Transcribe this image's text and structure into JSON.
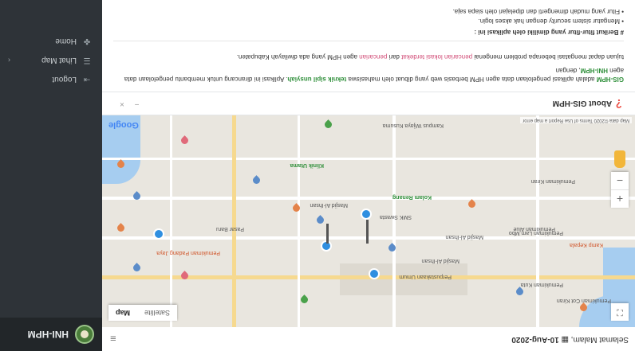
{
  "app": {
    "name": "HNI-HPM"
  },
  "sidebar": {
    "items": [
      {
        "label": "Home",
        "icon": "dashboard-icon"
      },
      {
        "label": "Lihat Map",
        "icon": "list-icon"
      },
      {
        "label": "Logout",
        "icon": "logout-icon"
      }
    ]
  },
  "header": {
    "greeting": "Selamat Malam, ",
    "datetime": "10-Aug-2020"
  },
  "map": {
    "type_map": "Map",
    "type_satellite": "Satellite",
    "zoom_in": "+",
    "zoom_out": "−",
    "fullscreen": "⛶",
    "attribution": "Map data ©2020   Terms of Use   Report a map error",
    "logo": "Google",
    "labels": [
      "Kampus Wijaya Kusuma",
      "Masjid Al-Ihsan",
      "SMK Swasta",
      "Perpustakaan Umum",
      "Pemukiman Kuta",
      "Klinik Utama",
      "Masjid Al-Ihsan",
      "Pasar Baru",
      "Pemukiman Padang Jaya",
      "Kolam Renang",
      "Pemukiman Alue",
      "Pemukiman Kiran",
      "Pemukiman Lam Mbo",
      "Pemukiman Cot Kiran",
      "Kamp Kepala",
      "Masjid Al-Ihsan"
    ]
  },
  "about": {
    "title": "About GIS-HPM",
    "minimize": "−",
    "close": "×",
    "intro_app": "GIS-HPM",
    "intro_text": " adalah aplikasi pengelolaan data agen HPM berbasis web yang dibuat oleh mahasiswa ",
    "intro_author": "teknik sipil unsyiah",
    "intro_rest": ". Aplikasi ini dirancang untuk membantu pengelolaan data agen ",
    "intro_agen": "HNI-HPM",
    "intro_end": ", dengan",
    "line2_a": "tujuan dapat mengatasi beberapa problem mengenai ",
    "line2_b": "pencarian  lokasi  terdekat",
    "line2_c": " dari ",
    "line2_d": "pencarian",
    "line2_e": " agen HPM yang ada diwilayah Kabupaten.",
    "features_title": "# Berikut fitur-fitur yang dimiliki oleh aplikasi ini :",
    "bullets": [
      "Mengatur sistem security dengan hak akses login.",
      "Fitur yang mudah dimengerti dan dipelajari oleh siapa saja."
    ]
  }
}
